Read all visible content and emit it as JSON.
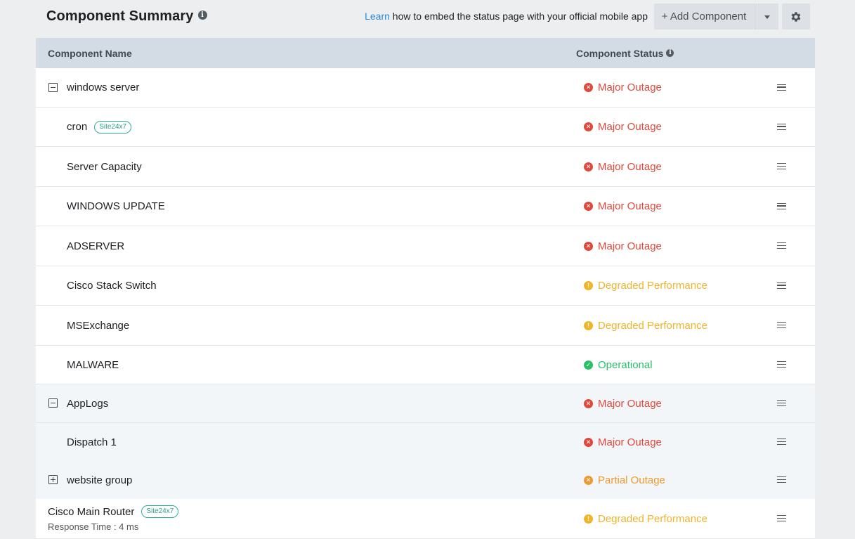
{
  "header": {
    "title": "Component Summary",
    "learn_link": "Learn",
    "learn_text": " how to embed the status page with your official mobile app",
    "add_button": "+ Add Component"
  },
  "table": {
    "col_name": "Component Name",
    "col_status": "Component Status"
  },
  "status_colors": {
    "major": "#e0483b",
    "degraded": "#f0b429",
    "operational": "#2bbf6a",
    "partial": "#ee9a2e"
  },
  "rows": [
    {
      "name": "windows server",
      "status": "Major Outage",
      "status_type": "major",
      "toggle": "collapse"
    },
    {
      "name": "cron",
      "badge": "Site24x7",
      "status": "Major Outage",
      "status_type": "major"
    },
    {
      "name": "Server Capacity",
      "status": "Major Outage",
      "status_type": "major"
    },
    {
      "name": "WINDOWS UPDATE",
      "status": "Major Outage",
      "status_type": "major"
    },
    {
      "name": "ADSERVER",
      "status": "Major Outage",
      "status_type": "major"
    },
    {
      "name": "Cisco Stack Switch",
      "status": "Degraded Performance",
      "status_type": "degraded"
    },
    {
      "name": "MSExchange",
      "status": "Degraded Performance",
      "status_type": "degraded"
    },
    {
      "name": "MALWARE",
      "status": "Operational",
      "status_type": "operational"
    },
    {
      "name": "AppLogs",
      "status": "Major Outage",
      "status_type": "major",
      "toggle": "collapse"
    },
    {
      "name": "Dispatch 1",
      "status": "Major Outage",
      "status_type": "major"
    },
    {
      "name": "website group",
      "status": "Partial Outage",
      "status_type": "partial",
      "toggle": "expand"
    },
    {
      "name": "Cisco Main Router",
      "badge": "Site24x7",
      "sub": "Response Time : 4 ms",
      "status": "Degraded Performance",
      "status_type": "degraded"
    }
  ]
}
